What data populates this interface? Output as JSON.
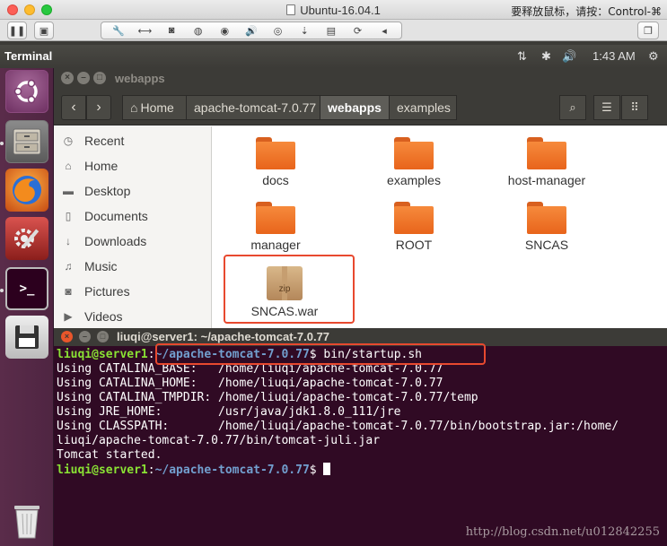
{
  "vm": {
    "title": "Ubuntu-16.04.1",
    "hint": "要释放鼠标，请按：Control-⌘"
  },
  "panel": {
    "title": "Terminal",
    "time": "1:43 AM"
  },
  "file_manager": {
    "title": "webapps",
    "breadcrumbs": [
      "Home",
      "apache-tomcat-7.0.77",
      "webapps",
      "examples"
    ],
    "sidebar": [
      "Recent",
      "Home",
      "Desktop",
      "Documents",
      "Downloads",
      "Music",
      "Pictures",
      "Videos"
    ],
    "files": [
      {
        "name": "docs",
        "type": "folder"
      },
      {
        "name": "examples",
        "type": "folder"
      },
      {
        "name": "host-manager",
        "type": "folder"
      },
      {
        "name": "manager",
        "type": "folder"
      },
      {
        "name": "ROOT",
        "type": "folder"
      },
      {
        "name": "SNCAS",
        "type": "folder"
      },
      {
        "name": "SNCAS.war",
        "type": "archive",
        "badge": "zip"
      }
    ]
  },
  "terminal": {
    "title": "liuqi@server1: ~/apache-tomcat-7.0.77",
    "prompt_user": "liuqi@server1",
    "prompt_path": "~/apache-tomcat-7.0.77",
    "command": "bin/startup.sh",
    "output": [
      "Using CATALINA_BASE:   /home/liuqi/apache-tomcat-7.0.77",
      "Using CATALINA_HOME:   /home/liuqi/apache-tomcat-7.0.77",
      "Using CATALINA_TMPDIR: /home/liuqi/apache-tomcat-7.0.77/temp",
      "Using JRE_HOME:        /usr/java/jdk1.8.0_111/jre",
      "Using CLASSPATH:       /home/liuqi/apache-tomcat-7.0.77/bin/bootstrap.jar:/home/",
      "liuqi/apache-tomcat-7.0.77/bin/tomcat-juli.jar",
      "Tomcat started."
    ],
    "watermark": "http://blog.csdn.net/u012842255"
  },
  "colors": {
    "highlight": "#e8492f",
    "terminal_bg": "#300a24",
    "launcher_bg": "#5a2c4a"
  }
}
